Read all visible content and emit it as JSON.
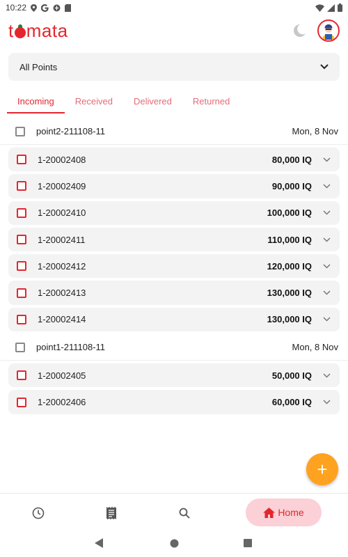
{
  "status_bar": {
    "time": "10:22",
    "left_icons": [
      "location-icon",
      "google-icon",
      "vpn-icon",
      "sim-icon"
    ],
    "right_icons": [
      "wifi-icon",
      "signal-icon",
      "battery-icon"
    ]
  },
  "app_bar": {
    "logo_text_before": "t",
    "logo_text_after": "mata",
    "theme_icon": "moon-icon",
    "avatar_icon": "avatar-icon"
  },
  "points_select": {
    "value": "All Points"
  },
  "tabs": [
    {
      "label": "Incoming",
      "active": true
    },
    {
      "label": "Received",
      "active": false
    },
    {
      "label": "Delivered",
      "active": false
    },
    {
      "label": "Returned",
      "active": false
    }
  ],
  "groups": [
    {
      "name": "point2-211108-11",
      "date": "Mon, 8 Nov",
      "items": [
        {
          "code": "1-20002408",
          "amount": "80,000 IQ"
        },
        {
          "code": "1-20002409",
          "amount": "90,000 IQ"
        },
        {
          "code": "1-20002410",
          "amount": "100,000 IQ"
        },
        {
          "code": "1-20002411",
          "amount": "110,000 IQ"
        },
        {
          "code": "1-20002412",
          "amount": "120,000 IQ"
        },
        {
          "code": "1-20002413",
          "amount": "130,000 IQ"
        },
        {
          "code": "1-20002414",
          "amount": "130,000 IQ"
        }
      ]
    },
    {
      "name": "point1-211108-11",
      "date": "Mon, 8 Nov",
      "items": [
        {
          "code": "1-20002405",
          "amount": "50,000 IQ"
        },
        {
          "code": "1-20002406",
          "amount": "60,000 IQ"
        }
      ]
    }
  ],
  "fab": {
    "label": "+"
  },
  "bottom_nav": {
    "items": [
      {
        "icon": "history-icon"
      },
      {
        "icon": "receipt-icon"
      },
      {
        "icon": "search-icon"
      }
    ],
    "home_label": "Home",
    "home_icon": "home-icon"
  },
  "colors": {
    "brand": "#e3262e",
    "tab_inactive": "#e56b7b",
    "fab": "#ffa21f",
    "home_pill": "#fbd0d6",
    "card_bg": "#f3f3f3"
  }
}
